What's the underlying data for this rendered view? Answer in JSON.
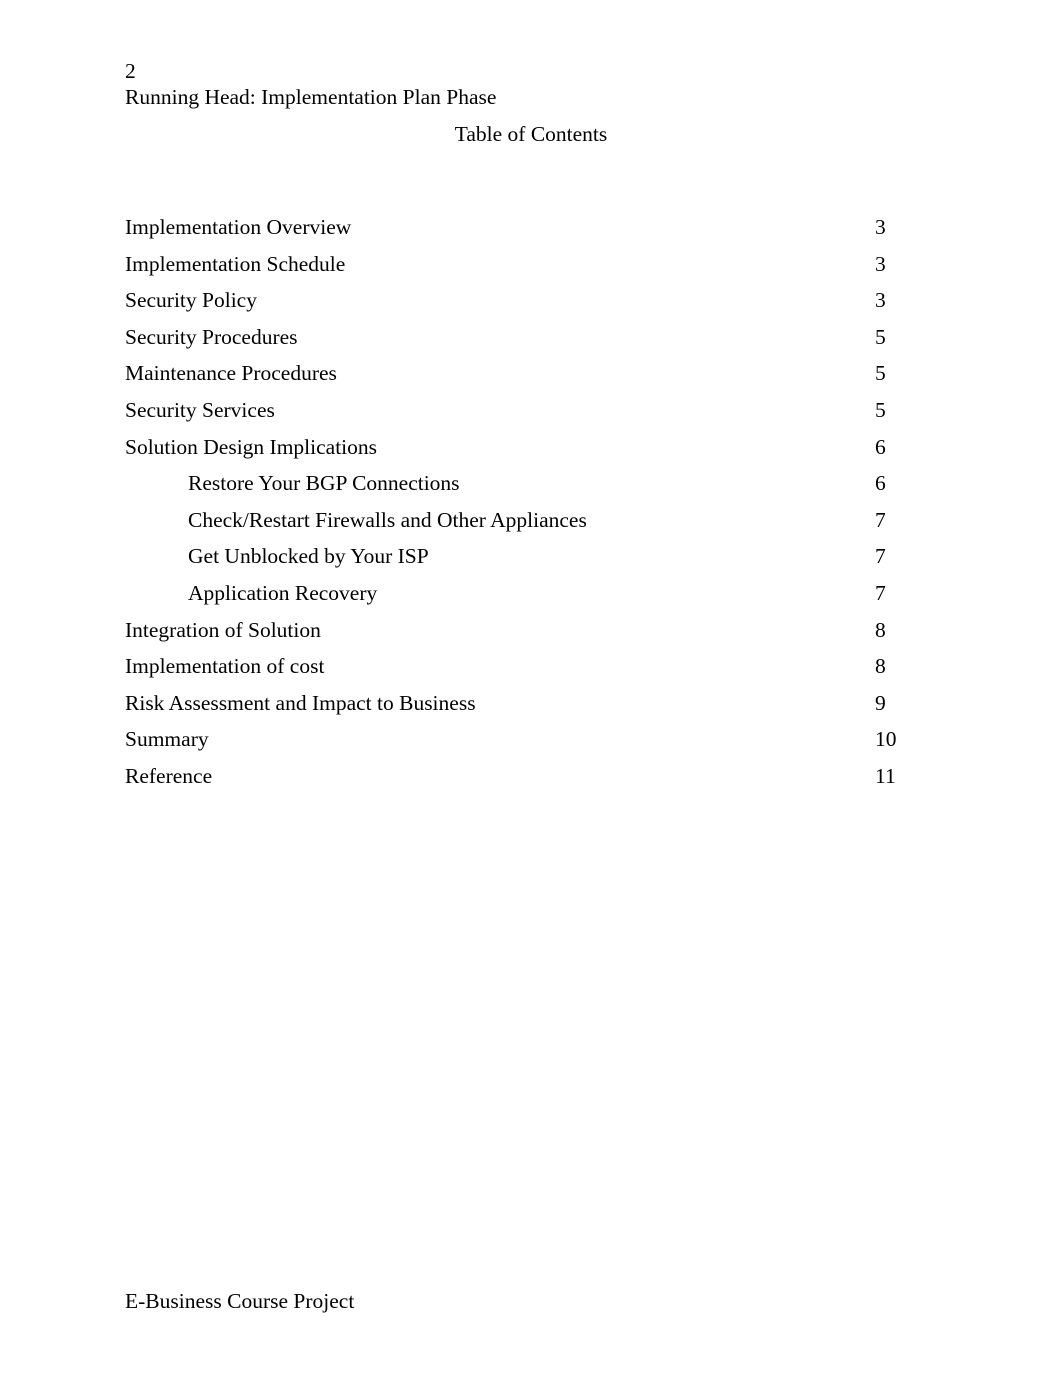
{
  "document": {
    "page_number": "2",
    "running_head": "Running Head: Implementation Plan Phase",
    "toc_heading": "Table of Contents",
    "footer": "E-Business Course Project",
    "text_color": "#000000",
    "background_color": "#ffffff"
  },
  "toc": {
    "entries": [
      {
        "title": "Implementation Overview",
        "page": "3",
        "level": 1
      },
      {
        "title": "Implementation Schedule",
        "page": "3",
        "level": 1
      },
      {
        "title": "Security Policy",
        "page": "3",
        "level": 1
      },
      {
        "title": "Security Procedures",
        "page": "5",
        "level": 1
      },
      {
        "title": "Maintenance Procedures",
        "page": "5",
        "level": 1
      },
      {
        "title": "Security Services",
        "page": "5",
        "level": 1
      },
      {
        "title": "Solution Design Implications",
        "page": "6",
        "level": 1
      },
      {
        "title": "Restore Your BGP Connections",
        "page": "6",
        "level": 2
      },
      {
        "title": "Check/Restart Firewalls and Other Appliances",
        "page": "7",
        "level": 2
      },
      {
        "title": "Get Unblocked by Your ISP",
        "page": "7",
        "level": 2
      },
      {
        "title": "Application Recovery",
        "page": "7",
        "level": 2
      },
      {
        "title": "Integration of Solution",
        "page": "8",
        "level": 1
      },
      {
        "title": "Implementation of cost",
        "page": "8",
        "level": 1
      },
      {
        "title": "Risk Assessment and Impact to Business",
        "page": "9",
        "level": 1
      },
      {
        "title": "Summary",
        "page": "10",
        "level": 1
      },
      {
        "title": "Reference",
        "page": "11",
        "level": 1
      }
    ]
  }
}
